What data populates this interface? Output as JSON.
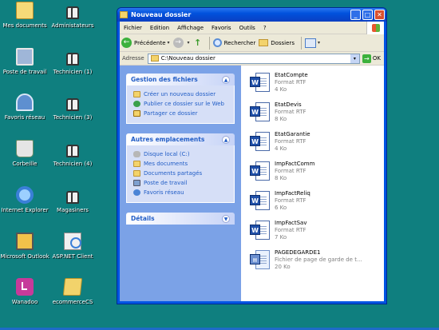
{
  "desktop": {
    "icons_left": [
      {
        "label": "Mes documents",
        "icon": "my-documents-icon"
      },
      {
        "label": "Poste de travail",
        "icon": "my-computer-icon"
      },
      {
        "label": "Favoris réseau",
        "icon": "network-places-icon"
      },
      {
        "label": "Corbeille",
        "icon": "recycle-bin-icon"
      },
      {
        "label": "Internet Explorer",
        "icon": "internet-explorer-icon"
      },
      {
        "label": "Microsoft Outlook",
        "icon": "outlook-icon"
      },
      {
        "label": "Wanadoo",
        "icon": "wanadoo-icon"
      }
    ],
    "icons_right": [
      {
        "label": "Administateurs",
        "icon": "users-icon"
      },
      {
        "label": "Technicien (1)",
        "icon": "users-icon"
      },
      {
        "label": "Technicien (3)",
        "icon": "users-icon"
      },
      {
        "label": "Technicien (4)",
        "icon": "users-icon"
      },
      {
        "label": "Magasiners",
        "icon": "users-icon"
      },
      {
        "label": "ASP.NET Client",
        "icon": "aspnet-icon"
      },
      {
        "label": "ecommerceCS",
        "icon": "folder-icon"
      }
    ]
  },
  "window": {
    "title": "Nouveau dossier",
    "menu": [
      "Fichier",
      "Edition",
      "Affichage",
      "Favoris",
      "Outils",
      "?"
    ],
    "toolbar": {
      "back": "Précédente",
      "search": "Rechercher",
      "folders": "Dossiers"
    },
    "address": {
      "label": "Adresse",
      "value": "C:\\Nouveau dossier",
      "go": "OK"
    },
    "tasks": {
      "title": "Gestion des fichiers",
      "items": [
        "Créer un nouveau dossier",
        "Publier ce dossier sur le Web",
        "Partager ce dossier"
      ]
    },
    "places": {
      "title": "Autres emplacements",
      "items": [
        "Disque local (C:)",
        "Mes documents",
        "Documents partagés",
        "Poste de travail",
        "Favoris réseau"
      ]
    },
    "details": {
      "title": "Détails"
    },
    "files": [
      {
        "name": "EtatCompte",
        "type": "Format RTF",
        "size": "4 Ko"
      },
      {
        "name": "EtatDevis",
        "type": "Format RTF",
        "size": "8 Ko"
      },
      {
        "name": "EtatGarantie",
        "type": "Format RTF",
        "size": "4 Ko"
      },
      {
        "name": "ImpFactComm",
        "type": "Format RTF",
        "size": "8 Ko"
      },
      {
        "name": "ImpFactReliq",
        "type": "Format RTF",
        "size": "6 Ko"
      },
      {
        "name": "ImpFactSav",
        "type": "Format RTF",
        "size": "7 Ko"
      },
      {
        "name": "PAGEDEGARDE1",
        "type": "Fichier de page de garde de t...",
        "size": "20 Ko"
      }
    ]
  }
}
